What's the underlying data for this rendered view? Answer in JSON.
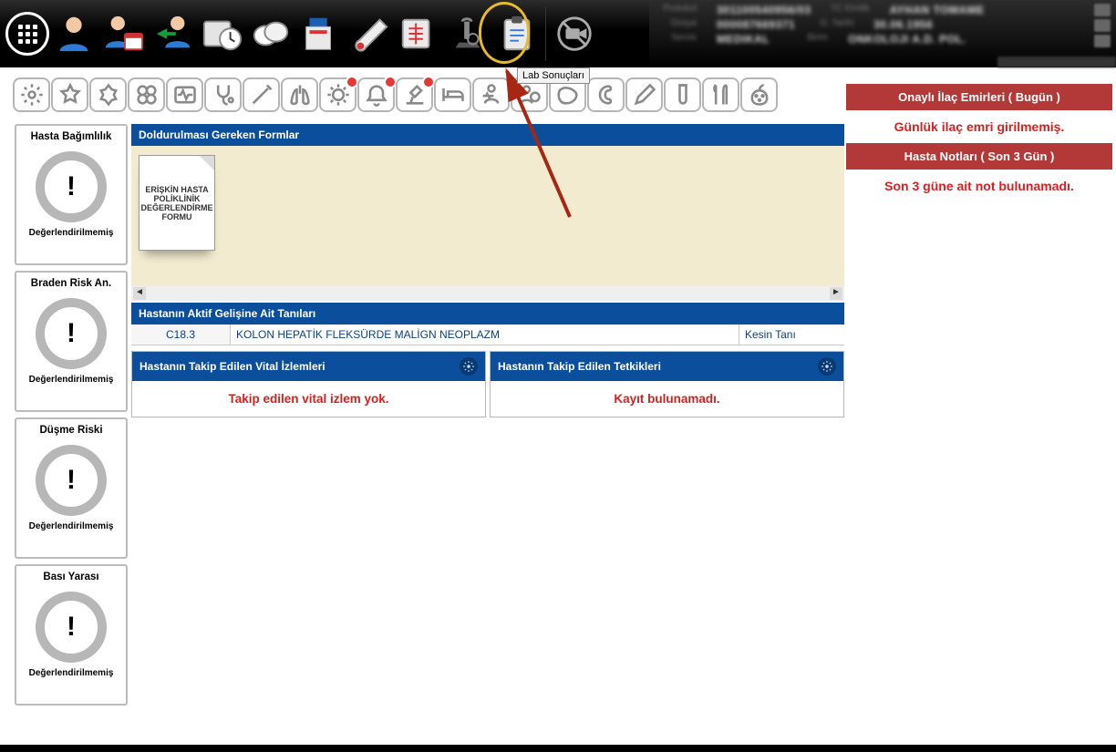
{
  "toolbar_tooltip": "Lab Sonuçları",
  "patient": {
    "l1a": "Protokol",
    "v1a": "301100540956/03",
    "l1b": "TC Kimlik",
    "v1b": "AYHAN TOMAME",
    "l2a": "Dosya",
    "v2a": "000087669371",
    "l2b": "D. Tarihi",
    "v2b": "30.06.1956",
    "l3a": "Servis",
    "v3a": "MEDIKAL",
    "l3b": "Birim",
    "v3b": "ONKOLOJI A.D. POL."
  },
  "risk_cards": [
    {
      "title": "Hasta Bağımlılık",
      "value": "!",
      "status": "Değerlendirilmemiş"
    },
    {
      "title": "Braden Risk An.",
      "value": "!",
      "status": "Değerlendirilmemiş"
    },
    {
      "title": "Düşme Riski",
      "value": "!",
      "status": "Değerlendirilmemiş"
    },
    {
      "title": "Bası Yarası",
      "value": "!",
      "status": "Değerlendirilmemiş"
    }
  ],
  "forms_header": "Doldurulması Gereken Formlar",
  "form_doc_label": "ERİŞKİN HASTA POLİKLİNİK DEĞERLENDİRME FORMU",
  "diag_header": "Hastanın Aktif Gelişine Ait Tanıları",
  "diag": {
    "code": "C18.3",
    "name": "KOLON HEPATİK FLEKSÜRDE MALİGN NEOPLAZM",
    "type": "Kesin Tanı"
  },
  "vital_header": "Hastanın Takip Edilen Vital İzlemleri",
  "vital_msg": "Takip edilen vital izlem yok.",
  "tests_header": "Hastanın Takip Edilen Tetkikleri",
  "tests_msg": "Kayıt bulunamadı.",
  "right": {
    "orders_header": "Onaylı İlaç Emirleri ( Bugün )",
    "orders_msg": "Günlük ilaç emri girilmemiş.",
    "notes_header": "Hasta Notları ( Son 3 Gün )",
    "notes_msg": "Son 3 güne ait not bulunamadı."
  }
}
